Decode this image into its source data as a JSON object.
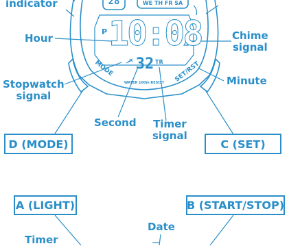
{
  "labels": {
    "indicator": "indicator",
    "hour": "Hour",
    "chime_line1": "Chime",
    "chime_line2": "signal",
    "stopwatch_line1": "Stopwatch",
    "stopwatch_line2": "signal",
    "minute": "Minute",
    "second": "Second",
    "timer_line1": "Timer",
    "timer_line2": "signal",
    "date": "Date",
    "timer_bottom": "Timer"
  },
  "buttons": {
    "d": "D (MODE)",
    "c": "C (SET)",
    "a": "A (LIGHT)",
    "b": "B (START/STOP)"
  },
  "watch": {
    "time_digits": "10:08",
    "seconds_digits": "32",
    "top_digits": "28",
    "day_row": "WE TH FR SA",
    "pm_mark": "P",
    "tr_mark": "TR",
    "mode_text": "MODE",
    "setrst_text": "SET/RST",
    "water_text": "WATER 100m RESIST",
    "left_top_letter": "P"
  }
}
